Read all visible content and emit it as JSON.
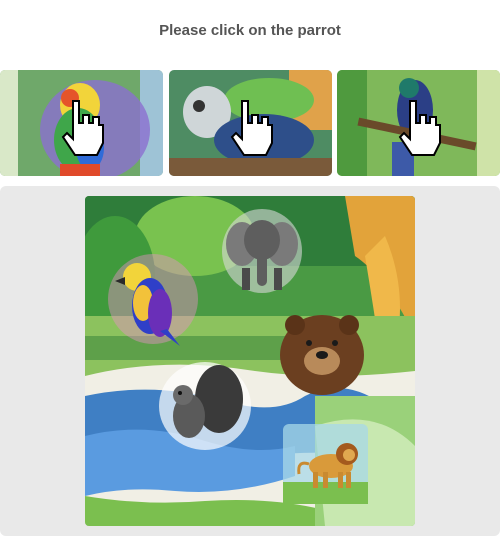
{
  "captcha": {
    "instruction": "Please click on the parrot"
  },
  "examples": [
    {
      "name": "example-tile-1",
      "subject": "parrot"
    },
    {
      "name": "example-tile-2",
      "subject": "parrot"
    },
    {
      "name": "example-tile-3",
      "subject": "parrot"
    }
  ],
  "scene": {
    "animals": [
      "elephant",
      "parrot",
      "bear",
      "squirrel",
      "lion"
    ]
  },
  "colors": {
    "instruction_text": "#555555",
    "panel_background": "#e9e9e9",
    "water": "#3f7fc4",
    "jungle_green": "#3e8f3a"
  }
}
